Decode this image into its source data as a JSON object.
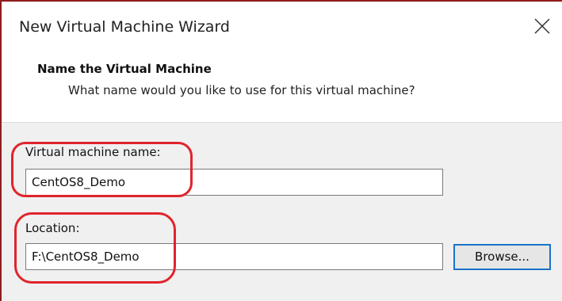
{
  "window": {
    "title": "New Virtual Machine Wizard",
    "close_icon": "close-icon"
  },
  "header": {
    "title": "Name the Virtual Machine",
    "subtitle": "What name would you like to use for this virtual machine?"
  },
  "form": {
    "vm_name_label": "Virtual machine name:",
    "vm_name_value": "CentOS8_Demo",
    "location_label": "Location:",
    "location_value": "F:\\CentOS8_Demo",
    "browse_label": "Browse..."
  },
  "colors": {
    "annotation": "#e0242c",
    "focus_border": "#1a73c8",
    "window_border": "#8f1d1d"
  }
}
